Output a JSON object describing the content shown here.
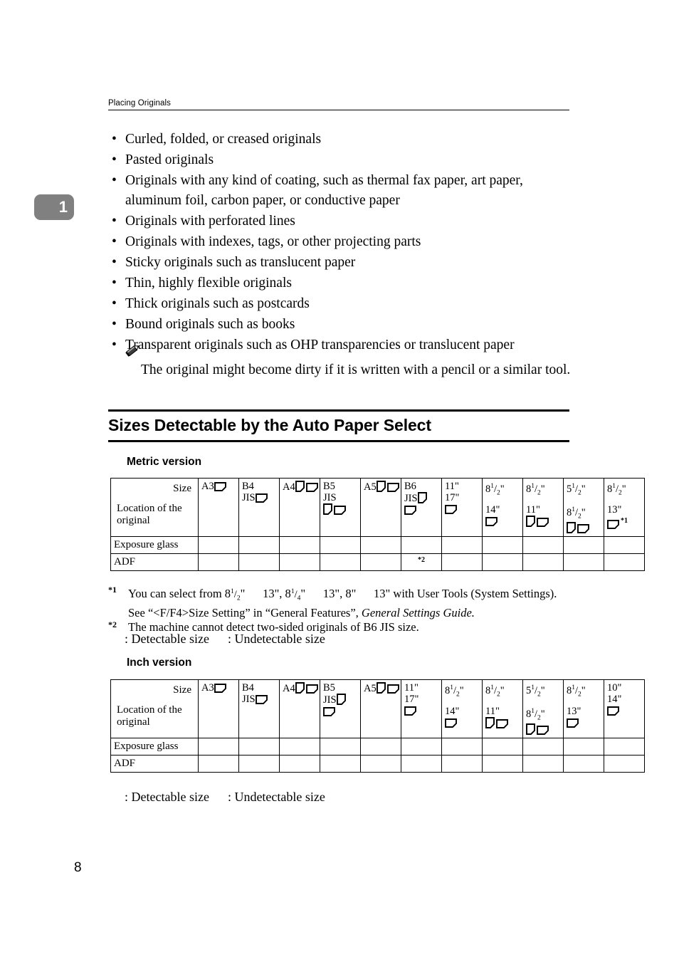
{
  "header": {
    "running_title": "Placing Originals"
  },
  "chapter_tab": {
    "number": "1"
  },
  "bullets": [
    "Curled, folded, or creased originals",
    "Pasted originals",
    "Originals with any kind of coating, such as thermal fax paper, art paper, aluminum foil, carbon paper, or conductive paper",
    "Originals with perforated lines",
    "Originals with indexes, tags, or other projecting parts",
    "Sticky originals such as translucent paper",
    "Thin, highly flexible originals",
    "Thick originals such as postcards",
    "Bound originals such as books",
    "Transparent originals such as OHP transparencies or translucent paper"
  ],
  "note": {
    "icon": "pencil-icon",
    "text": "The original might become dirty if it is written with a pencil or a similar tool."
  },
  "section": {
    "title": "Sizes Detectable by the Auto Paper Select"
  },
  "metric": {
    "sub_heading": "Metric version",
    "corner_size_label": "Size",
    "corner_location_label": "Location of the original",
    "row_labels": [
      "Exposure glass",
      "ADF"
    ],
    "columns": [
      {
        "line1": "A3",
        "icons1": [
          "landscape"
        ],
        "line2": "",
        "icons2": []
      },
      {
        "line1": "B4",
        "icons1": [],
        "line2": "JIS",
        "icons2": [
          "landscape"
        ],
        "inline": true
      },
      {
        "line1": "A4",
        "icons1": [
          "portrait",
          "landscape"
        ],
        "line2": "",
        "icons2": []
      },
      {
        "line1": "B5",
        "icons1": [],
        "line2": "JIS",
        "icons2": [
          "portrait",
          "landscape"
        ],
        "stacked": true
      },
      {
        "line1": "A5",
        "icons1": [
          "portrait",
          "landscape"
        ],
        "line2": "",
        "icons2": []
      },
      {
        "line1": "B6",
        "icons1": [],
        "line2": "JIS",
        "icons2": [
          "portrait",
          "landscape"
        ],
        "b6": true
      },
      {
        "line1": "11\"",
        "icons1": [],
        "line2": "17\"",
        "icons2": [
          "landscape"
        ]
      },
      {
        "line1": "8_1_2",
        "icons1": [],
        "line2": "14\"",
        "icons2": [
          "landscape"
        ]
      },
      {
        "line1": "8_1_2",
        "icons1": [],
        "line2": "11\"",
        "icons2": [
          "portrait",
          "landscape"
        ]
      },
      {
        "line1": "5_1_2",
        "icons1": [],
        "line2": "8_1_2",
        "icons2": [
          "portrait",
          "landscape"
        ]
      },
      {
        "line1": "8_1_2",
        "icons1": [],
        "line2": "13\"",
        "icons2": [
          "landscape"
        ],
        "footnote": "*1"
      }
    ],
    "adf_marks": [
      "",
      "",
      "",
      "",
      "",
      "*2",
      "",
      "",
      "",
      "",
      ""
    ],
    "exposure_marks": [
      "",
      "",
      "",
      "",
      "",
      "",
      "",
      "",
      "",
      "",
      ""
    ]
  },
  "inch": {
    "sub_heading": "Inch version",
    "corner_size_label": "Size",
    "corner_location_label": "Location of the original",
    "row_labels": [
      "Exposure glass",
      "ADF"
    ],
    "columns": [
      {
        "line1": "A3",
        "icons1": [
          "landscape"
        ],
        "line2": "",
        "icons2": []
      },
      {
        "line1": "B4",
        "icons1": [],
        "line2": "JIS",
        "icons2": [
          "landscape"
        ],
        "inline": true
      },
      {
        "line1": "A4",
        "icons1": [
          "portrait",
          "landscape"
        ],
        "line2": "",
        "icons2": []
      },
      {
        "line1": "B5",
        "icons1": [],
        "line2": "JIS",
        "icons2": [
          "portrait",
          "landscape"
        ],
        "b6": true
      },
      {
        "line1": "A5",
        "icons1": [
          "portrait",
          "landscape"
        ],
        "line2": "",
        "icons2": []
      },
      {
        "line1": "11\"",
        "icons1": [],
        "line2": "17\"",
        "icons2": [
          "landscape"
        ]
      },
      {
        "line1": "8_1_2",
        "icons1": [],
        "line2": "14\"",
        "icons2": [
          "landscape"
        ]
      },
      {
        "line1": "8_1_2",
        "icons1": [],
        "line2": "11\"",
        "icons2": [
          "portrait",
          "landscape"
        ]
      },
      {
        "line1": "5_1_2",
        "icons1": [],
        "line2": "8_1_2",
        "icons2": [
          "portrait",
          "landscape"
        ]
      },
      {
        "line1": "8_1_2",
        "icons1": [],
        "line2": "13\"",
        "icons2": [
          "landscape"
        ]
      },
      {
        "line1": "10\"",
        "icons1": [],
        "line2": "14\"",
        "icons2": [
          "landscape"
        ]
      }
    ],
    "adf_marks": [
      "",
      "",
      "",
      "",
      "",
      "",
      "",
      "",
      "",
      "",
      ""
    ],
    "exposure_marks": [
      "",
      "",
      "",
      "",
      "",
      "",
      "",
      "",
      "",
      "",
      ""
    ]
  },
  "footnotes": [
    {
      "mark": "*1",
      "parts": [
        {
          "t": "You can select from 8"
        },
        {
          "frac": "1/2"
        },
        {
          "t": "\"   13\", 8"
        },
        {
          "frac": "1/4"
        },
        {
          "t": "\"   13\", 8\"   13\" with User Tools (System Settings)."
        }
      ],
      "line2_prefix": "See “<F/F4>Size Setting” in “General Features”, ",
      "line2_italic": "General Settings Guide."
    },
    {
      "mark": "*2",
      "plain": "The machine cannot detect two-sided originals of B6 JIS size."
    }
  ],
  "legend": {
    "detectable": ": Detectable size",
    "undetectable": ": Undetectable size"
  },
  "page_number": "8"
}
